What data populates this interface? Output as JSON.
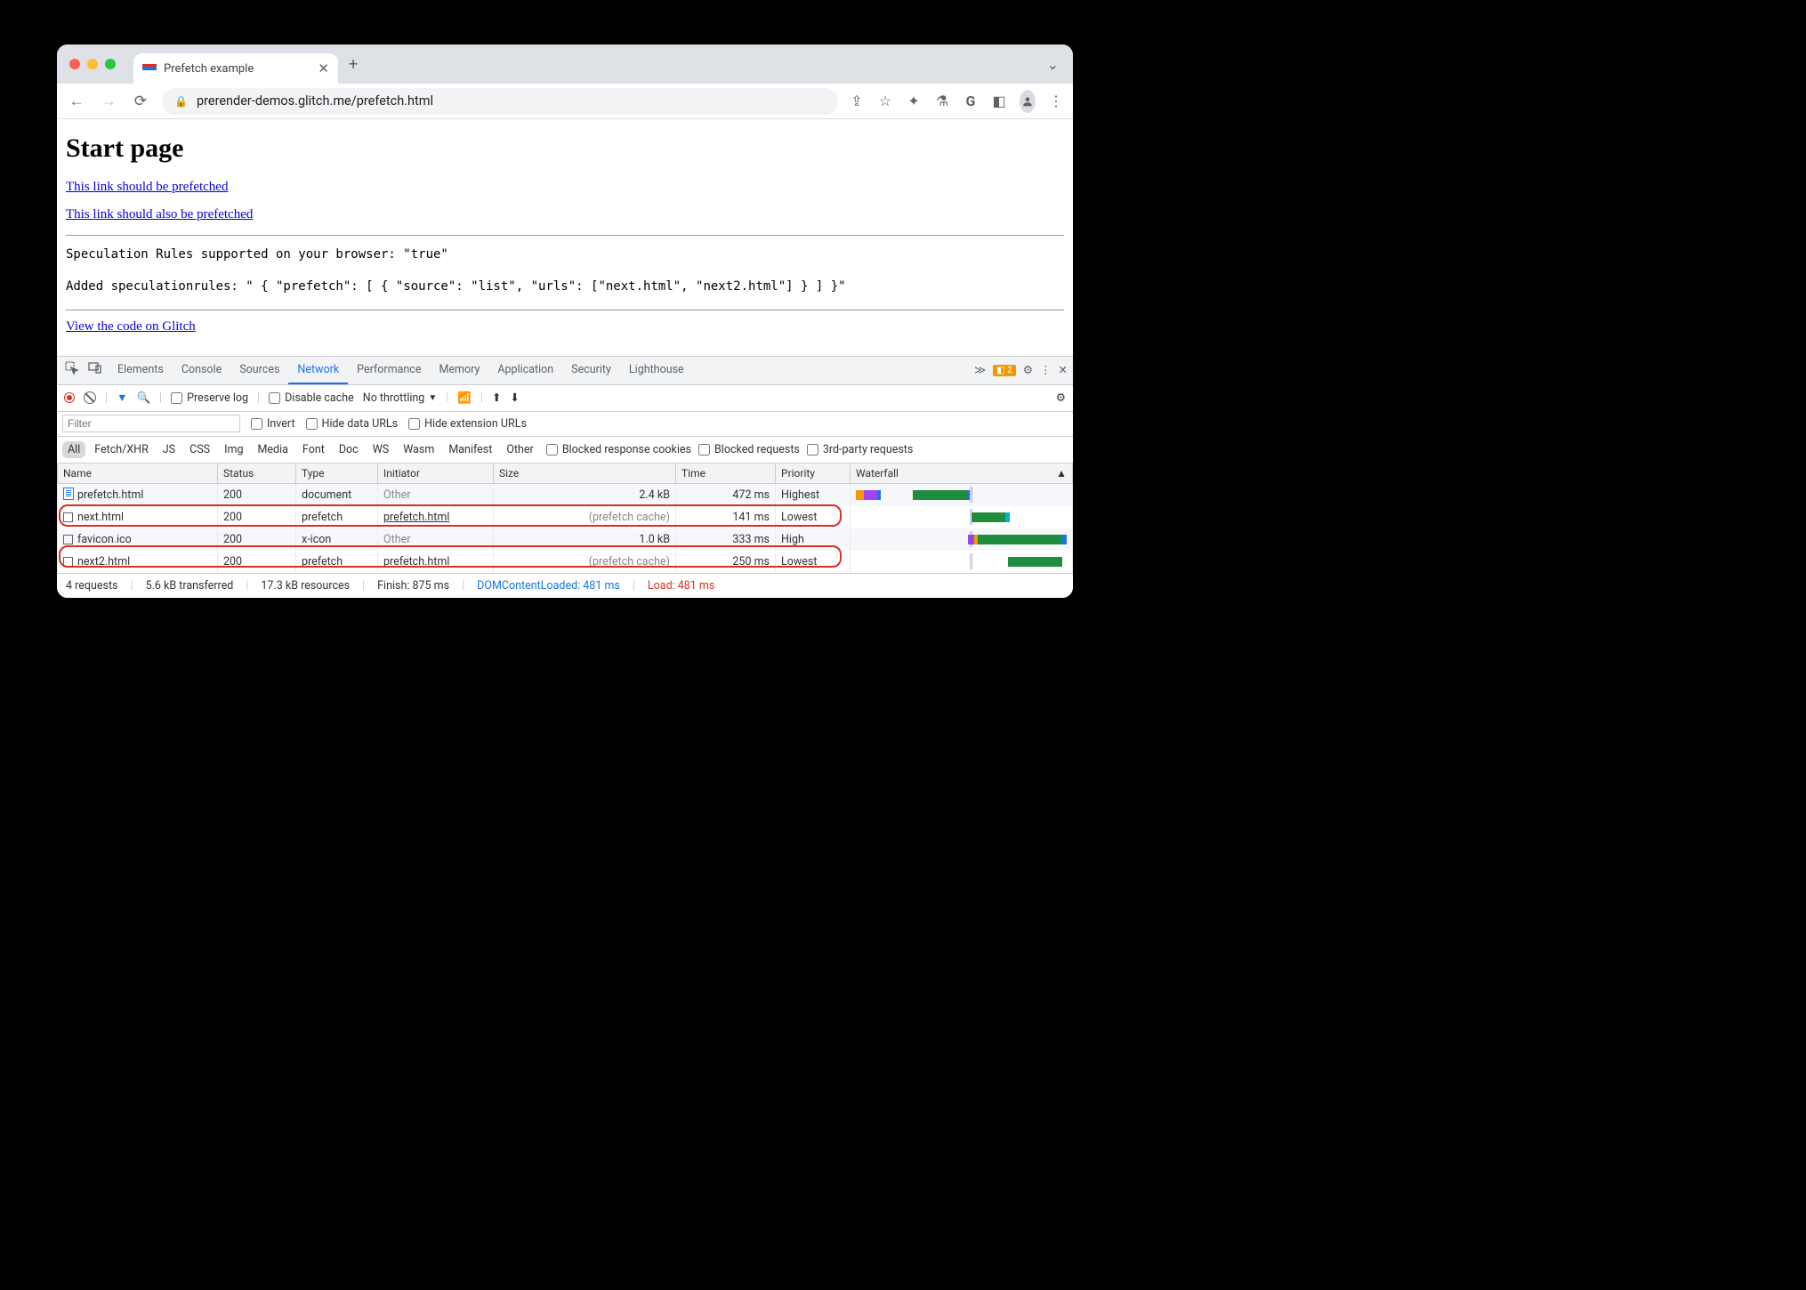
{
  "browser": {
    "tab_title": "Prefetch example",
    "url": "prerender-demos.glitch.me/prefetch.html"
  },
  "page": {
    "heading": "Start page",
    "link1": "This link should be prefetched",
    "link2": "This link should also be prefetched",
    "rule_supported": "Speculation Rules supported on your browser: \"true\"",
    "rules_added": "Added speculationrules: \" { \"prefetch\": [ { \"source\": \"list\", \"urls\": [\"next.html\", \"next2.html\"] } ] }\"",
    "glitch_link": "View the code on Glitch"
  },
  "devtools": {
    "tabs": [
      "Elements",
      "Console",
      "Sources",
      "Network",
      "Performance",
      "Memory",
      "Application",
      "Security",
      "Lighthouse"
    ],
    "issues_count": "2",
    "network_bar": {
      "preserve_log": "Preserve log",
      "disable_cache": "Disable cache",
      "throttling": "No throttling"
    },
    "filter_placeholder": "Filter",
    "invert": "Invert",
    "hide_data": "Hide data URLs",
    "hide_ext": "Hide extension URLs",
    "types": [
      "All",
      "Fetch/XHR",
      "JS",
      "CSS",
      "Img",
      "Media",
      "Font",
      "Doc",
      "WS",
      "Wasm",
      "Manifest",
      "Other"
    ],
    "blocked_cookies": "Blocked response cookies",
    "blocked_req": "Blocked requests",
    "third_party": "3rd-party requests",
    "columns": [
      "Name",
      "Status",
      "Type",
      "Initiator",
      "Size",
      "Time",
      "Priority",
      "Waterfall"
    ],
    "rows": [
      {
        "name": "prefetch.html",
        "status": "200",
        "type": "document",
        "initiator": "Other",
        "initiator_dimmed": true,
        "size": "2.4 kB",
        "time": "472 ms",
        "priority": "Highest",
        "icon": "doc",
        "highlight": false
      },
      {
        "name": "next.html",
        "status": "200",
        "type": "prefetch",
        "initiator": "prefetch.html",
        "initiator_dimmed": false,
        "size": "(prefetch cache)",
        "time": "141 ms",
        "priority": "Lowest",
        "icon": "sq",
        "highlight": true
      },
      {
        "name": "favicon.ico",
        "status": "200",
        "type": "x-icon",
        "initiator": "Other",
        "initiator_dimmed": true,
        "size": "1.0 kB",
        "time": "333 ms",
        "priority": "High",
        "icon": "sq",
        "highlight": false
      },
      {
        "name": "next2.html",
        "status": "200",
        "type": "prefetch",
        "initiator": "prefetch.html",
        "initiator_dimmed": false,
        "size": "(prefetch cache)",
        "time": "250 ms",
        "priority": "Lowest",
        "icon": "sq",
        "highlight": true
      }
    ],
    "footer": {
      "requests": "4 requests",
      "transferred": "5.6 kB transferred",
      "resources": "17.3 kB resources",
      "finish": "Finish: 875 ms",
      "dcl": "DOMContentLoaded: 481 ms",
      "load": "Load: 481 ms"
    }
  }
}
